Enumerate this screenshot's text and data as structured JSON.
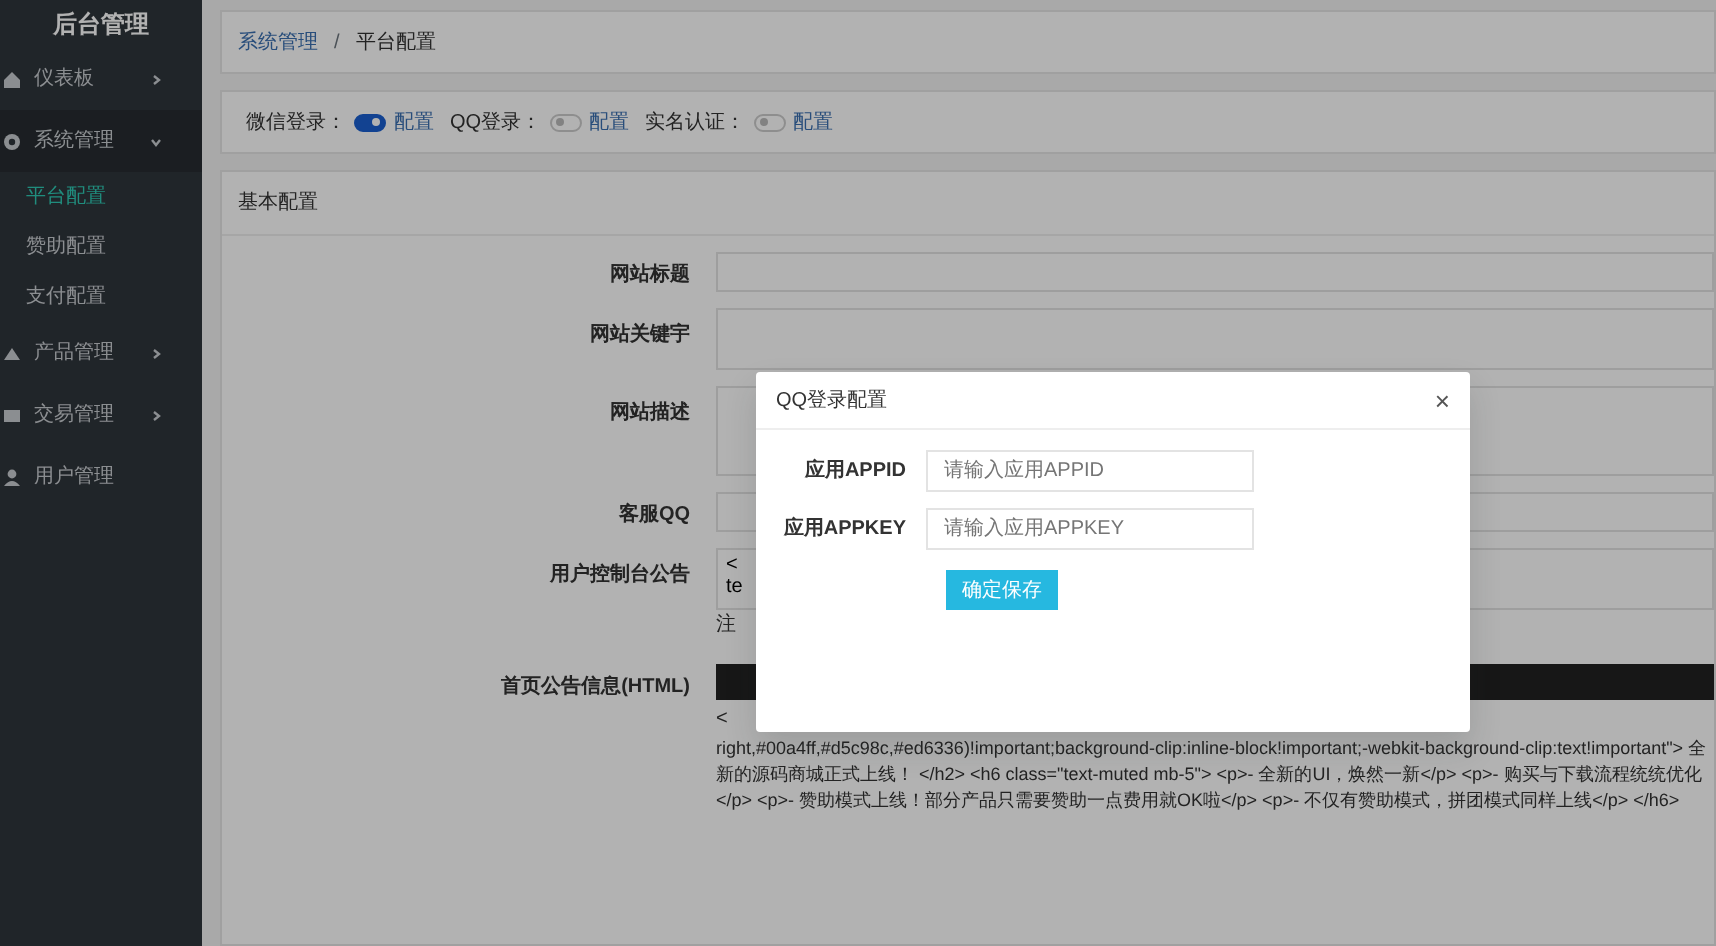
{
  "sidebar": {
    "title": "后台管理",
    "items": [
      {
        "label": "仪表板",
        "expanded": false
      },
      {
        "label": "系统管理",
        "expanded": true,
        "children": [
          {
            "label": "平台配置",
            "selected": true
          },
          {
            "label": "赞助配置",
            "selected": false
          },
          {
            "label": "支付配置",
            "selected": false
          }
        ]
      },
      {
        "label": "产品管理",
        "expanded": false
      },
      {
        "label": "交易管理",
        "expanded": false
      },
      {
        "label": "用户管理"
      }
    ]
  },
  "breadcrumb": {
    "separator": "/",
    "items": [
      "系统管理",
      "平台配置"
    ]
  },
  "login_switches": [
    {
      "label": "微信登录：",
      "on": true,
      "link": "配置"
    },
    {
      "label": "QQ登录：",
      "on": false,
      "link": "配置"
    },
    {
      "label": "实名认证：",
      "on": false,
      "link": "配置"
    }
  ],
  "basic_config": {
    "title": "基本配置",
    "fields": [
      {
        "label": "网站标题",
        "kind": "input"
      },
      {
        "label": "网站关键宇",
        "kind": "textarea"
      },
      {
        "label": "网站描述",
        "kind": "tall-textarea"
      },
      {
        "label": "客服QQ",
        "kind": "input"
      },
      {
        "label": "用户控制台公告",
        "kind": "textarea",
        "value": "<\nte",
        "note": "注"
      },
      {
        "label": "首页公告信息(HTML)",
        "kind": "editor",
        "first_line": "<",
        "value": "right,#00a4ff,#d5c98c,#ed6336)!important;background-clip:inline-block!important;-webkit-background-clip:text!important\"> 全新的源码商城正式上线！ </h2> <h6 class=\"text-muted mb-5\"> <p>- 全新的UI，焕然一新</p> <p>- 购买与下载流程统统优化</p> <p>- 赞助模式上线！部分产品只需要赞助一点费用就OK啦</p> <p>- 不仅有赞助模式，拼团模式同样上线</p> </h6>"
      }
    ]
  },
  "modal": {
    "title": "QQ登录配置",
    "close": "×",
    "fields": [
      {
        "label": "应用APPID",
        "placeholder": "请输入应用APPID"
      },
      {
        "label": "应用APPKEY",
        "placeholder": "请输入应用APPKEY"
      }
    ],
    "button": "确定保存"
  }
}
